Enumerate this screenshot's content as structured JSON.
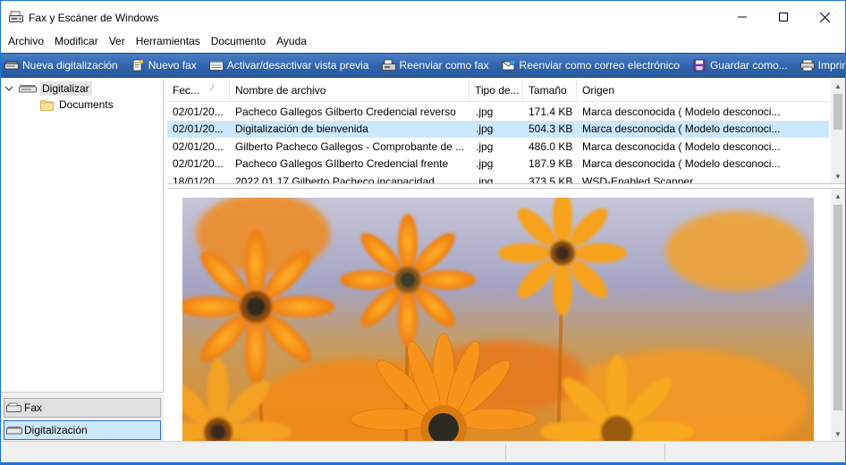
{
  "window": {
    "title": "Fax y Escáner de Windows",
    "controls": {
      "minimize": "—",
      "maximize": "☐",
      "close": "✕"
    }
  },
  "menu": [
    "Archivo",
    "Modificar",
    "Ver",
    "Herramientas",
    "Documento",
    "Ayuda"
  ],
  "toolbar": {
    "new_scan": "Nueva digitalización",
    "new_fax": "Nuevo fax",
    "toggle_preview": "Activar/desactivar vista previa",
    "forward_fax": "Reenviar como fax",
    "forward_email": "Reenviar como correo electrónico",
    "save_as": "Guardar como...",
    "print": "Imprimir"
  },
  "tree": {
    "root": "Digitalizar",
    "child": "Documents"
  },
  "nav": {
    "fax": "Fax",
    "scan": "Digitalización"
  },
  "list": {
    "headers": [
      "Fec...",
      "Nombre de archivo",
      "Tipo de...",
      "Tamaño",
      "Origen"
    ],
    "rows": [
      {
        "date": "02/01/20...",
        "name": "Pacheco Gallegos Gilberto Credencial reverso",
        "type": ".jpg",
        "size": "171.4 KB",
        "origin": "Marca desconocida ( Modelo desconoci..."
      },
      {
        "date": "02/01/20...",
        "name": "Digitalización de bienvenida",
        "type": ".jpg",
        "size": "504.3 KB",
        "origin": "Marca desconocida ( Modelo desconoci..."
      },
      {
        "date": "02/01/20...",
        "name": "Gilberto Pacheco Gallegos - Comprobante de ...",
        "type": ".jpg",
        "size": "486.0 KB",
        "origin": "Marca desconocida ( Modelo desconoci..."
      },
      {
        "date": "02/01/20...",
        "name": "Pacheco Gallegos GIlberto Credencial frente",
        "type": ".jpg",
        "size": "187.9 KB",
        "origin": "Marca desconocida ( Modelo desconoci..."
      },
      {
        "date": "18/01/20...",
        "name": "2022 01 17 Gilberto Pacheco incapacidad",
        "type": ".jpg",
        "size": "373.5 KB",
        "origin": "WSD-Enabled Scanner"
      }
    ],
    "selected_index": 1
  },
  "colors": {
    "toolbar": "#2f63ab",
    "selection": "#cce8ff",
    "window_border": "#1a73d9"
  }
}
